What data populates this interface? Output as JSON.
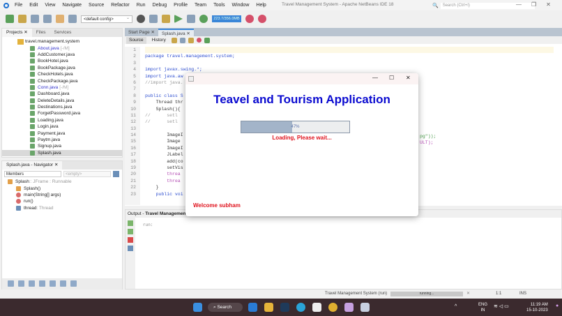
{
  "window": {
    "title": "Travel Management System - Apache NetBeans IDE 18",
    "search_placeholder": "Search (Ctrl+I)"
  },
  "menu": [
    "File",
    "Edit",
    "View",
    "Navigate",
    "Source",
    "Refactor",
    "Run",
    "Debug",
    "Profile",
    "Team",
    "Tools",
    "Window",
    "Help"
  ],
  "toolbar": {
    "config": "<default config>",
    "memory": "223.7/356.0MB"
  },
  "projects": {
    "tabs": [
      "Projects",
      "Files",
      "Services"
    ],
    "root": "travel.management.system",
    "files": [
      {
        "name": "About.java",
        "suffix": "[-/M]",
        "modified": true
      },
      {
        "name": "AddCustomer.java"
      },
      {
        "name": "BookHotel.java"
      },
      {
        "name": "BookPackage.java"
      },
      {
        "name": "CheckHotels.java"
      },
      {
        "name": "CheckPackage.java"
      },
      {
        "name": "Conn.java",
        "suffix": "[-/M]",
        "modified": true
      },
      {
        "name": "Dashboard.java"
      },
      {
        "name": "DeleteDetails.java"
      },
      {
        "name": "Destinations.java"
      },
      {
        "name": "ForgetPassword.java"
      },
      {
        "name": "Loading.java"
      },
      {
        "name": "Login.java"
      },
      {
        "name": "Payment.java"
      },
      {
        "name": "Paytm.java"
      },
      {
        "name": "Signup.java"
      },
      {
        "name": "Splash.java",
        "selected": true
      }
    ]
  },
  "navigator": {
    "title": "Splash.java - Navigator",
    "filter": "Members",
    "empty": "<empty>",
    "class_name": "Splash",
    "class_type": " :: JFrame : Runnable",
    "members": [
      {
        "name": "Splash()",
        "type": ""
      },
      {
        "name": "main(String[] args)",
        "type": ""
      },
      {
        "name": "run()",
        "type": ""
      },
      {
        "name": "thread",
        "type": " : Thread"
      }
    ]
  },
  "editor": {
    "tabs": [
      "Start Page",
      "Splash.java"
    ],
    "source_tab": "Source",
    "history_tab": "History",
    "lines": [
      "",
      "package travel.management.system;",
      "",
      "import javax.swing.*;",
      "import java.aw",
      "//import java.",
      "",
      "public class S",
      "    Thread thr",
      "    Splash(){",
      "//      setl",
      "//      setl",
      "",
      "        ImageI",
      "        Image",
      "        ImageI",
      "        JLabel",
      "        add(co",
      "        setVis",
      "        threa",
      "        threa",
      "    }",
      "    public voi"
    ],
    "fragment1": "pg\"));",
    "fragment2": "ULT);"
  },
  "output": {
    "title_prefix": "Output - ",
    "title": "Travel Management",
    "text": "run:"
  },
  "status": {
    "task": "Travel Management System (run)",
    "progress_label": "running...",
    "position": "1:1",
    "mode": "INS"
  },
  "splash": {
    "heading": "Teavel and Tourism Application",
    "progress_percent": 47,
    "progress_text": "47%",
    "loading": "Loading, Please wait...",
    "welcome": "Welcome subham"
  },
  "taskbar": {
    "search": "Search",
    "lang": "ENG",
    "region": "IN",
    "time": "11:19 AM",
    "date": "15-10-2023"
  }
}
